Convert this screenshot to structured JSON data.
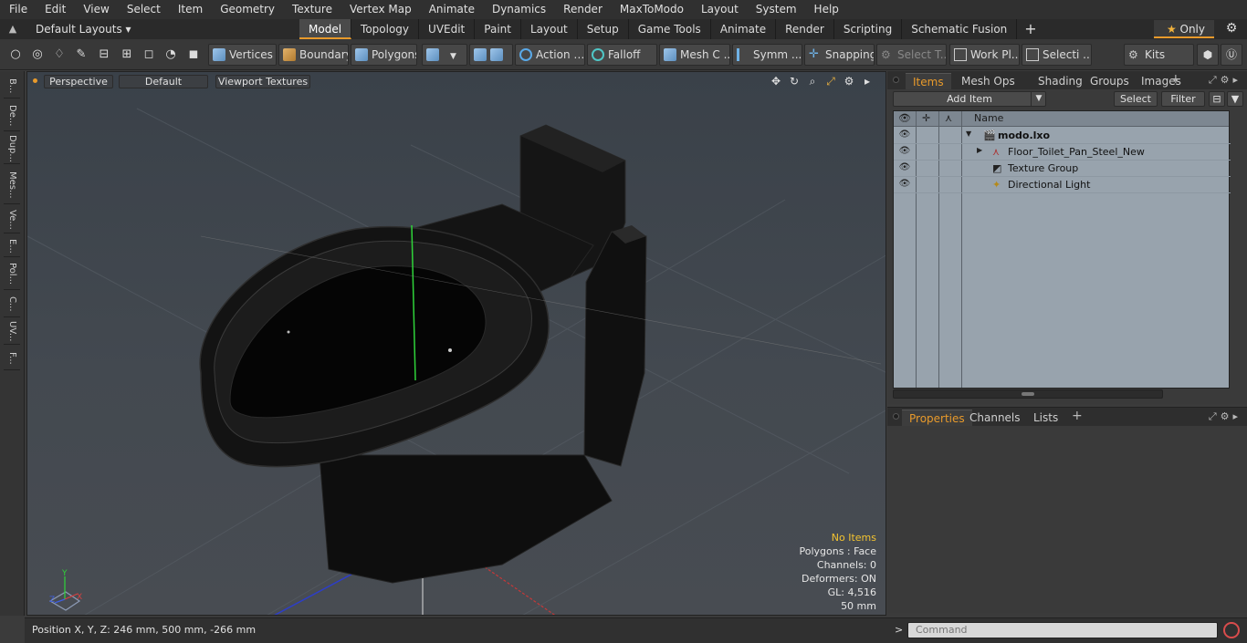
{
  "menu": [
    "File",
    "Edit",
    "View",
    "Select",
    "Item",
    "Geometry",
    "Texture",
    "Vertex Map",
    "Animate",
    "Dynamics",
    "Render",
    "MaxToModo",
    "Layout",
    "System",
    "Help"
  ],
  "layout": {
    "layouts_label": "Default Layouts ▾",
    "tabs": [
      "Model",
      "Topology",
      "UVEdit",
      "Paint",
      "Layout",
      "Setup",
      "Game Tools",
      "Animate",
      "Render",
      "Scripting",
      "Schematic Fusion"
    ],
    "active_tab": "Model",
    "only_label": "Only"
  },
  "toolbar": {
    "vertices": "Vertices",
    "boundary": "Boundary",
    "polygons": "Polygons",
    "action": "Action",
    "falloff": "Falloff",
    "mesh_c": "Mesh C ...",
    "symm": "Symm ...",
    "snapping": "Snapping",
    "select_t": "Select T...",
    "work_pl": "Work Pl...",
    "selecti": "Selecti ...",
    "kits": "Kits"
  },
  "left_tabs": [
    "B...",
    "De...",
    "Dup...",
    "Mes...",
    "Ve...",
    "E...",
    "Pol...",
    "C...",
    "UV...",
    "F..."
  ],
  "viewport": {
    "view_mode": "Perspective",
    "shading": "Default",
    "textures": "Viewport Textures",
    "hud": {
      "no_items": "No Items",
      "polygons": "Polygons : Face",
      "channels": "Channels: 0",
      "deformers": "Deformers: ON",
      "gl": "GL: 4,516",
      "scale": "50 mm"
    }
  },
  "status": {
    "position": "Position X, Y, Z:  246 mm, 500 mm, -266 mm"
  },
  "items_panel": {
    "tabs": [
      "Items",
      "Mesh Ops",
      "Shading",
      "Groups",
      "Images"
    ],
    "active_tab": "Items",
    "add_item": "Add Item",
    "select": "Select",
    "filter": "Filter",
    "name_header": "Name",
    "rows": [
      {
        "name": "modo.lxo",
        "level": 0,
        "bold": true,
        "expanded": true
      },
      {
        "name": "Floor_Toilet_Pan_Steel_New",
        "level": 1,
        "bold": false,
        "expanded": false
      },
      {
        "name": "Texture Group",
        "level": 1,
        "bold": false
      },
      {
        "name": "Directional Light",
        "level": 1,
        "bold": false
      }
    ]
  },
  "properties_panel": {
    "tabs": [
      "Properties",
      "Channels",
      "Lists"
    ],
    "active_tab": "Properties"
  },
  "command": {
    "placeholder": "Command"
  }
}
